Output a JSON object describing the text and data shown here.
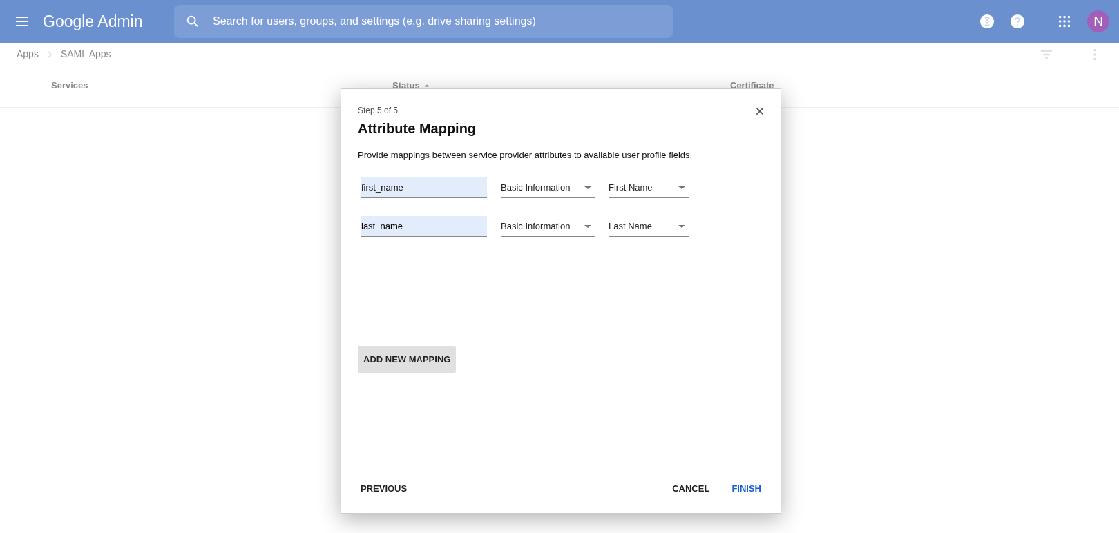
{
  "header": {
    "app_name": "Google Admin",
    "search": {
      "placeholder": "Search for users, groups, and settings (e.g. drive sharing settings)"
    },
    "avatar": "N"
  },
  "breadcrumb": [
    "Apps",
    "SAML Apps"
  ],
  "table": {
    "columns": [
      {
        "label": "Services",
        "sorted": false
      },
      {
        "label": "Status",
        "sorted": true
      },
      {
        "label": "Certificate",
        "sorted": false
      }
    ]
  },
  "dialog": {
    "step": "Step 5 of 5",
    "title": "Attribute Mapping",
    "description": "Provide mappings between service provider attributes to available user profile fields.",
    "mappings": [
      {
        "attribute": "first_name",
        "category": "Basic Information",
        "field": "First Name"
      },
      {
        "attribute": "last_name",
        "category": "Basic Information",
        "field": "Last Name"
      }
    ],
    "add_button": "ADD NEW MAPPING",
    "buttons": [
      {
        "label": "PREVIOUS",
        "kind": "secondary"
      },
      {
        "label": "CANCEL",
        "kind": "secondary"
      },
      {
        "label": "FINISH",
        "kind": "primary"
      }
    ]
  }
}
